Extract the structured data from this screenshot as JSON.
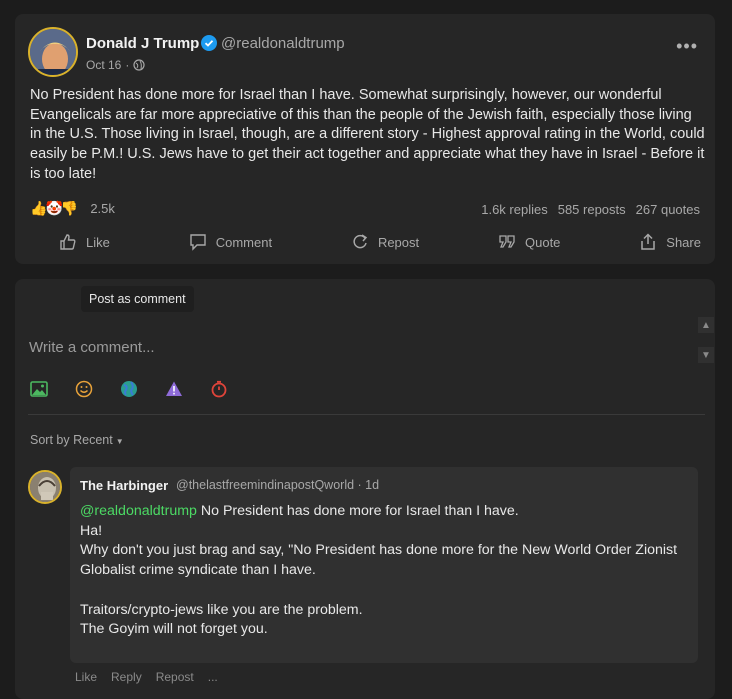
{
  "post": {
    "author_name": "Donald J Trump",
    "handle": "@realdonaldtrump",
    "date": "Oct 16",
    "meta_sep": "·",
    "text": "No President has done more for Israel than I have. Somewhat surprisingly, however, our wonderful Evangelicals are far more appreciative of this than the people of the Jewish faith, especially those living in the U.S. Those living in Israel, though, are a different story - Highest approval rating in the World, could easily be P.M.! U.S. Jews have to get their act together and appreciate what they have in Israel - Before it is too late!",
    "reactions": [
      "👍",
      "🤡",
      "👎"
    ],
    "reaction_count": "2.5k",
    "replies": "1.6k replies",
    "reposts": "585 reposts",
    "quotes": "267 quotes",
    "more_label": "•••"
  },
  "actions": {
    "like": "Like",
    "comment": "Comment",
    "repost": "Repost",
    "quote": "Quote",
    "share": "Share"
  },
  "composer": {
    "post_as": "Post as comment",
    "placeholder": "Write a comment...",
    "scroll_up": "▲",
    "scroll_down": "▼",
    "sort_label": "Sort by",
    "sort_value": "Recent",
    "tool_icons": [
      "image-icon",
      "emoji-icon",
      "globe-icon",
      "warning-icon",
      "timer-icon"
    ]
  },
  "comment": {
    "author_name": "The Harbinger",
    "handle_meta": "@thelastfreemindinapostQworld · 1d",
    "mention": "@realdonaldtrump",
    "text_first": " No President has done more for Israel than I have.",
    "text_rest": "Ha!\nWhy don't you just brag and say, \"No President has done more for the New World Order Zionist Globalist crime syndicate than I have.\n\nTraitors/crypto-jews like you are the problem.\nThe Goyim will not forget you.",
    "actions": [
      "Like",
      "Reply",
      "Repost",
      "..."
    ]
  },
  "colors": {
    "accent_green": "#4cd964",
    "verified_blue": "#1d9bf0",
    "avatar_ring": "#d9b22b"
  }
}
